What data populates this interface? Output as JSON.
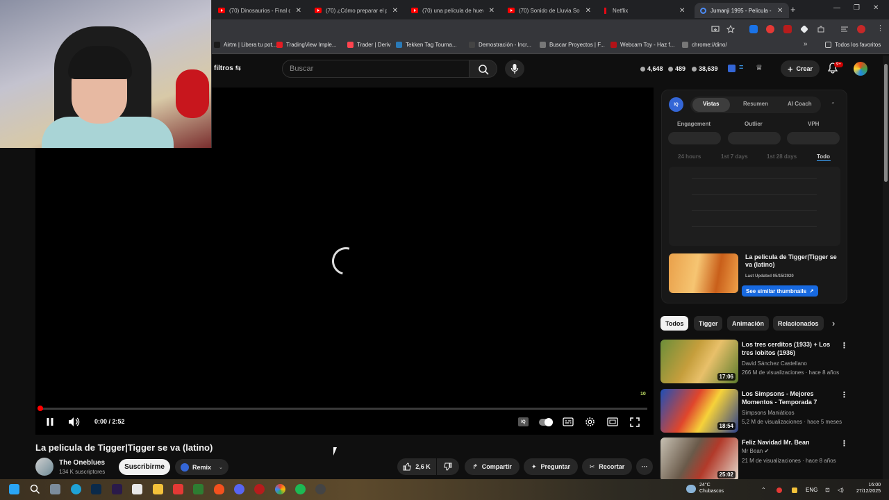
{
  "browser": {
    "tabs": [
      {
        "title": "(70) Dinosaurios - Final de",
        "type": "youtube"
      },
      {
        "title": "(70) ¿Cómo preparar el pa",
        "type": "youtube"
      },
      {
        "title": "(70) una película de huev",
        "type": "youtube"
      },
      {
        "title": "(70) Sonido de Lluvia Sob",
        "type": "youtube"
      },
      {
        "title": "Netflix",
        "type": "netflix"
      },
      {
        "title": "Jumanji 1995 - Pelicula - C",
        "type": "loading"
      }
    ],
    "bookmarks": [
      {
        "label": "Airtm | Libera tu pot...",
        "color": "#1a1a1a"
      },
      {
        "label": "TradingView Imple...",
        "color": "#e51c23"
      },
      {
        "label": "Trader | Deriv",
        "color": "#ff444f"
      },
      {
        "label": "Tekken Tag Tourna...",
        "color": "#2a7ab8"
      },
      {
        "label": "Demostración - Incr...",
        "color": "#444444"
      },
      {
        "label": "Buscar Proyectos | F...",
        "color": "#777777"
      },
      {
        "label": "Webcam Toy - Haz f...",
        "color": "#b31217"
      },
      {
        "label": "chrome://dino/",
        "color": "#777777"
      }
    ],
    "bookmarks_folder": "Todos los favoritos"
  },
  "header": {
    "filters_label": "filtros",
    "search_placeholder": "Buscar",
    "stats": [
      "4,648",
      "489",
      "38,639"
    ],
    "create_label": "Crear",
    "notif_badge": "9+"
  },
  "player": {
    "time": "0:00 / 2:52",
    "progress": 0.005,
    "quality_badge": "10"
  },
  "video": {
    "title": "La pelicula de Tigger|Tigger se va (latino)",
    "channel": "The Oneblues",
    "subscribers": "134 K suscriptores",
    "subscribe_label": "Suscribirme",
    "remix_label": "Remix",
    "likes": "2,6 K",
    "share_label": "Compartir",
    "ask_label": "Preguntar",
    "clip_label": "Recortar"
  },
  "iq": {
    "logo": "IQ",
    "tabs": [
      "Vistas",
      "Resumen",
      "AI Coach"
    ],
    "metrics": [
      "Engagement",
      "Outlier",
      "VPH"
    ],
    "ranges": [
      "24 hours",
      "1st 7 days",
      "1st 28 days",
      "Todo"
    ],
    "video_title": "La pelicula de Tigger|Tigger se va (latino)",
    "last_updated": "Last Updated 05/15/2020",
    "similar_label": "See similar thumbnails"
  },
  "chips": [
    "Todos",
    "Tigger",
    "Animación",
    "Relacionados"
  ],
  "recommendations": [
    {
      "title": "Los tres cerditos (1933) + Los tres lobitos (1936)",
      "channel": "David Sánchez Castellano",
      "meta": "266 M de visualizaciones · hace 8 años",
      "duration": "17:06",
      "thumb": "linear-gradient(120deg,#6b8e3a,#c59e3c 40%,#e8c06a 60%,#5b7b2c)"
    },
    {
      "title": "Los Simpsons - Mejores Momentos - Temporada 7",
      "channel": "Simpsons Maniáticos",
      "meta": "5,2 M de visualizaciones · hace 5 meses",
      "duration": "18:54",
      "thumb": "linear-gradient(120deg,#1d4fb8,#e0462c 40%,#f6d23a 60%,#2b3f8a)"
    },
    {
      "title": "Feliz Navidad Mr. Bean",
      "channel": "Mr Bean",
      "meta": "21 M de visualizaciones · hace 8 años",
      "duration": "25:02",
      "thumb": "linear-gradient(120deg,#c8c2b4,#6a5a4a 40%,#b23a2a 60%,#e4ddd0)"
    }
  ],
  "taskbar": {
    "weather_temp": "24°C",
    "weather_desc": "Chubascos",
    "lang": "ENG",
    "time": "16:00",
    "date": "27/12/2025"
  }
}
